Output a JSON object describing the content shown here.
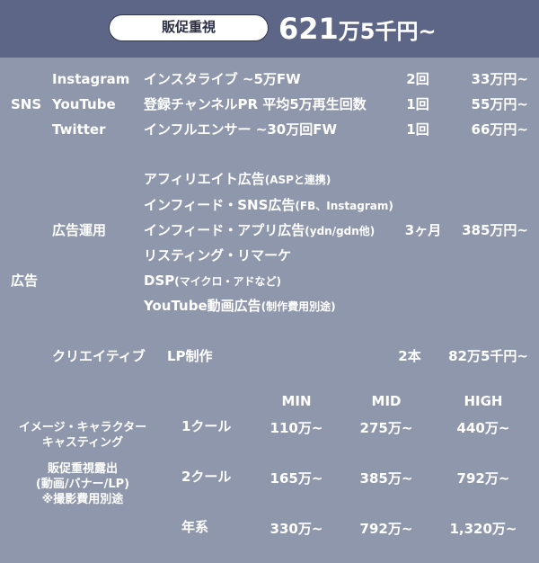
{
  "header": {
    "badge": "販促重視",
    "price_main": "621",
    "price_unit": "万5千円~"
  },
  "sns": {
    "section_label": "SNS",
    "rows": [
      {
        "platform": "Instagram",
        "content": "インスタライブ ~5万FW",
        "count": "2回",
        "price": "33万円~"
      },
      {
        "platform": "YouTube",
        "content": "登録チャンネルPR 平均5万再生回数",
        "count": "1回",
        "price": "55万円~"
      },
      {
        "platform": "Twitter",
        "content": "インフルエンサー ~30万回FW",
        "count": "1回",
        "price": "66万円~"
      }
    ]
  },
  "ads": {
    "section_label": "広告",
    "group_label": "広告運用",
    "items": [
      {
        "main": "アフィリエイト広告",
        "note": "(ASPと連携)"
      },
      {
        "main": "インフィード・SNS広告",
        "note": "(FB、Instagram)"
      },
      {
        "main": "インフィード・アプリ広告",
        "note": "(ydn/gdn他)"
      },
      {
        "main": "リスティング・リマーケ",
        "note": ""
      },
      {
        "main": "DSP",
        "note": "(マイクロ・アドなど)"
      },
      {
        "main": "YouTube動画広告",
        "note": "(制作費用別途)"
      }
    ],
    "count": "3ヶ月",
    "price": "385万円~",
    "creative_label": "クリエイティブ",
    "creative_item": "LP制作",
    "creative_count": "2本",
    "creative_price": "82万5千円~"
  },
  "casting": {
    "label_lines": [
      "イメージ・キャラクター",
      "キャスティング"
    ],
    "sub_lines": [
      "販促重視露出",
      "(動画/バナー/LP)",
      "※撮影費用別途"
    ],
    "columns": [
      "MIN",
      "MID",
      "HIGH"
    ],
    "rows": [
      {
        "term": "1クール",
        "values": [
          "110万~",
          "275万~",
          "440万~"
        ]
      },
      {
        "term": "2クール",
        "values": [
          "165万~",
          "385万~",
          "792万~"
        ]
      },
      {
        "term": "年系",
        "values": [
          "330万~",
          "792万~",
          "1,320万~"
        ]
      }
    ]
  }
}
